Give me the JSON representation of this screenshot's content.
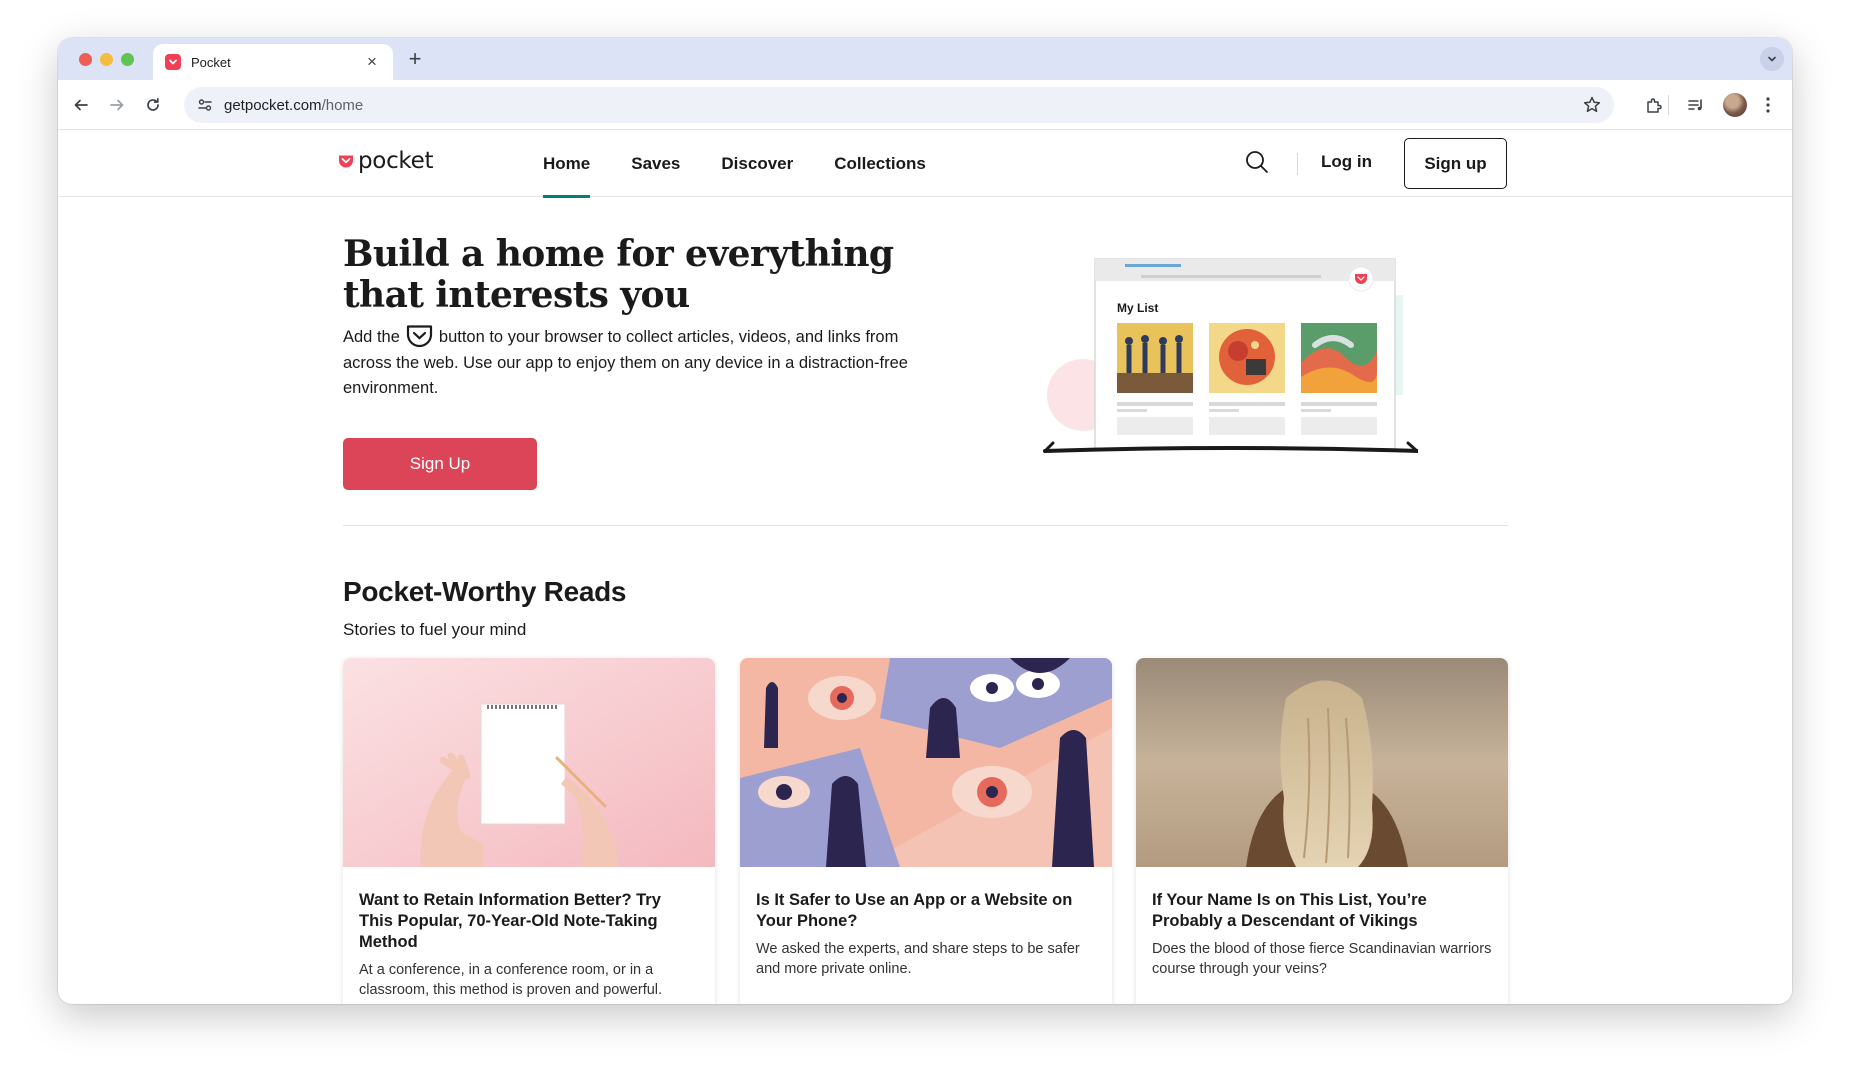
{
  "browser": {
    "tab_title": "Pocket",
    "url_domain": "getpocket.com",
    "url_path": "/home"
  },
  "header": {
    "logo_text": "pocket",
    "nav": [
      {
        "label": "Home",
        "active": true
      },
      {
        "label": "Saves",
        "active": false
      },
      {
        "label": "Discover",
        "active": false
      },
      {
        "label": "Collections",
        "active": false
      }
    ],
    "login_label": "Log in",
    "signup_label": "Sign up"
  },
  "hero": {
    "title": "Build a home for everything that interests you",
    "desc_before": "Add the",
    "desc_after": "button to your browser to collect articles, videos, and links from across the web. Use our app to enjoy them on any device in a distraction-free environment.",
    "cta_label": "Sign Up",
    "illustration_title": "My List"
  },
  "reads": {
    "title": "Pocket-Worthy Reads",
    "subtitle": "Stories to fuel your mind",
    "cards": [
      {
        "title": "Want to Retain Information Better? Try This Popular, 70-Year-Old Note-Taking Method",
        "excerpt": "At a conference, in a conference room, or in a classroom, this method is proven and powerful.",
        "image": "hands-notepad-illustration"
      },
      {
        "title": "Is It Safer to Use an App or a Website on Your Phone?",
        "excerpt": "We asked the experts, and share steps to be safer and more private online.",
        "image": "surveillance-eyes-illustration"
      },
      {
        "title": "If Your Name Is on This List, You’re Probably a Descendant of Vikings",
        "excerpt": "Does the blood of those fierce Scandinavian warriors course through your veins?",
        "image": "blonde-woman-photo"
      }
    ]
  },
  "colors": {
    "pocket_red": "#ef4056",
    "cta_red": "#dc4457",
    "active_teal": "#008078",
    "tabstrip": "#dde3f6"
  }
}
